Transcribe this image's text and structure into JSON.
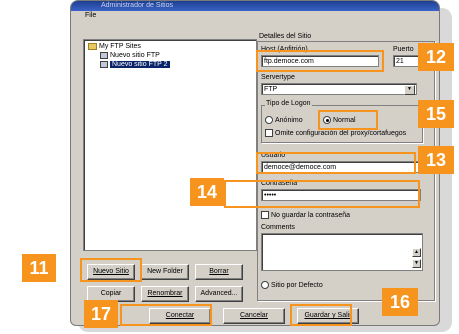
{
  "window": {
    "title": "Administrador de Sitios",
    "menu": "File"
  },
  "tree": {
    "root": "My FTP Sites",
    "items": [
      "Nuevo sitio FTP",
      "Nuevo sitio FTP 2"
    ]
  },
  "details": {
    "group_label": "Detalles del Sitio",
    "host_label": "Host (Anfitrión)",
    "host_value": "ftp.democe.com",
    "port_label": "Puerto",
    "port_value": "21",
    "servertype_label": "Servertype",
    "servertype_value": "FTP",
    "logon_label": "Tipo de Logon",
    "logon_anon": "Anónimo",
    "logon_normal": "Normal",
    "proxy_label": "Omite configuración del proxy/cortafuegos",
    "user_label": "Usuario",
    "user_value": "democe@democe.com",
    "pass_label": "Contraseña",
    "pass_value": "•••••",
    "nosave_label": "No guardar la contraseña",
    "comments_label": "Comments",
    "default_label": "Sitio por Defecto"
  },
  "buttons": {
    "new_site": "Nuevo Sitio",
    "new_folder": "New Folder",
    "delete": "Borrar",
    "copy": "Copiar",
    "rename": "Renombrar",
    "advanced": "Advanced...",
    "connect": "Conectar",
    "cancel": "Cancelar",
    "save": "Guardar y Salir"
  },
  "callouts": [
    "11",
    "12",
    "13",
    "14",
    "15",
    "16",
    "17"
  ],
  "colors": {
    "callout": "#f7941d",
    "selection": "#0a246a",
    "window": "#d4d0c8"
  }
}
